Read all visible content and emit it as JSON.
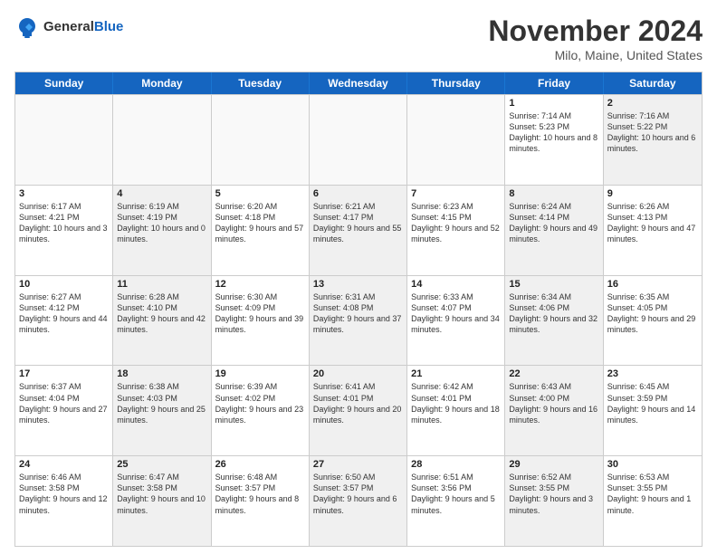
{
  "header": {
    "logo_general": "General",
    "logo_blue": "Blue",
    "title": "November 2024",
    "location": "Milo, Maine, United States"
  },
  "weekdays": [
    "Sunday",
    "Monday",
    "Tuesday",
    "Wednesday",
    "Thursday",
    "Friday",
    "Saturday"
  ],
  "rows": [
    [
      {
        "day": "",
        "text": "",
        "shaded": false,
        "empty": true
      },
      {
        "day": "",
        "text": "",
        "shaded": false,
        "empty": true
      },
      {
        "day": "",
        "text": "",
        "shaded": false,
        "empty": true
      },
      {
        "day": "",
        "text": "",
        "shaded": false,
        "empty": true
      },
      {
        "day": "",
        "text": "",
        "shaded": false,
        "empty": true
      },
      {
        "day": "1",
        "text": "Sunrise: 7:14 AM\nSunset: 5:23 PM\nDaylight: 10 hours and 8 minutes.",
        "shaded": false,
        "empty": false
      },
      {
        "day": "2",
        "text": "Sunrise: 7:16 AM\nSunset: 5:22 PM\nDaylight: 10 hours and 6 minutes.",
        "shaded": true,
        "empty": false
      }
    ],
    [
      {
        "day": "3",
        "text": "Sunrise: 6:17 AM\nSunset: 4:21 PM\nDaylight: 10 hours and 3 minutes.",
        "shaded": false,
        "empty": false
      },
      {
        "day": "4",
        "text": "Sunrise: 6:19 AM\nSunset: 4:19 PM\nDaylight: 10 hours and 0 minutes.",
        "shaded": true,
        "empty": false
      },
      {
        "day": "5",
        "text": "Sunrise: 6:20 AM\nSunset: 4:18 PM\nDaylight: 9 hours and 57 minutes.",
        "shaded": false,
        "empty": false
      },
      {
        "day": "6",
        "text": "Sunrise: 6:21 AM\nSunset: 4:17 PM\nDaylight: 9 hours and 55 minutes.",
        "shaded": true,
        "empty": false
      },
      {
        "day": "7",
        "text": "Sunrise: 6:23 AM\nSunset: 4:15 PM\nDaylight: 9 hours and 52 minutes.",
        "shaded": false,
        "empty": false
      },
      {
        "day": "8",
        "text": "Sunrise: 6:24 AM\nSunset: 4:14 PM\nDaylight: 9 hours and 49 minutes.",
        "shaded": true,
        "empty": false
      },
      {
        "day": "9",
        "text": "Sunrise: 6:26 AM\nSunset: 4:13 PM\nDaylight: 9 hours and 47 minutes.",
        "shaded": false,
        "empty": false
      }
    ],
    [
      {
        "day": "10",
        "text": "Sunrise: 6:27 AM\nSunset: 4:12 PM\nDaylight: 9 hours and 44 minutes.",
        "shaded": false,
        "empty": false
      },
      {
        "day": "11",
        "text": "Sunrise: 6:28 AM\nSunset: 4:10 PM\nDaylight: 9 hours and 42 minutes.",
        "shaded": true,
        "empty": false
      },
      {
        "day": "12",
        "text": "Sunrise: 6:30 AM\nSunset: 4:09 PM\nDaylight: 9 hours and 39 minutes.",
        "shaded": false,
        "empty": false
      },
      {
        "day": "13",
        "text": "Sunrise: 6:31 AM\nSunset: 4:08 PM\nDaylight: 9 hours and 37 minutes.",
        "shaded": true,
        "empty": false
      },
      {
        "day": "14",
        "text": "Sunrise: 6:33 AM\nSunset: 4:07 PM\nDaylight: 9 hours and 34 minutes.",
        "shaded": false,
        "empty": false
      },
      {
        "day": "15",
        "text": "Sunrise: 6:34 AM\nSunset: 4:06 PM\nDaylight: 9 hours and 32 minutes.",
        "shaded": true,
        "empty": false
      },
      {
        "day": "16",
        "text": "Sunrise: 6:35 AM\nSunset: 4:05 PM\nDaylight: 9 hours and 29 minutes.",
        "shaded": false,
        "empty": false
      }
    ],
    [
      {
        "day": "17",
        "text": "Sunrise: 6:37 AM\nSunset: 4:04 PM\nDaylight: 9 hours and 27 minutes.",
        "shaded": false,
        "empty": false
      },
      {
        "day": "18",
        "text": "Sunrise: 6:38 AM\nSunset: 4:03 PM\nDaylight: 9 hours and 25 minutes.",
        "shaded": true,
        "empty": false
      },
      {
        "day": "19",
        "text": "Sunrise: 6:39 AM\nSunset: 4:02 PM\nDaylight: 9 hours and 23 minutes.",
        "shaded": false,
        "empty": false
      },
      {
        "day": "20",
        "text": "Sunrise: 6:41 AM\nSunset: 4:01 PM\nDaylight: 9 hours and 20 minutes.",
        "shaded": true,
        "empty": false
      },
      {
        "day": "21",
        "text": "Sunrise: 6:42 AM\nSunset: 4:01 PM\nDaylight: 9 hours and 18 minutes.",
        "shaded": false,
        "empty": false
      },
      {
        "day": "22",
        "text": "Sunrise: 6:43 AM\nSunset: 4:00 PM\nDaylight: 9 hours and 16 minutes.",
        "shaded": true,
        "empty": false
      },
      {
        "day": "23",
        "text": "Sunrise: 6:45 AM\nSunset: 3:59 PM\nDaylight: 9 hours and 14 minutes.",
        "shaded": false,
        "empty": false
      }
    ],
    [
      {
        "day": "24",
        "text": "Sunrise: 6:46 AM\nSunset: 3:58 PM\nDaylight: 9 hours and 12 minutes.",
        "shaded": false,
        "empty": false
      },
      {
        "day": "25",
        "text": "Sunrise: 6:47 AM\nSunset: 3:58 PM\nDaylight: 9 hours and 10 minutes.",
        "shaded": true,
        "empty": false
      },
      {
        "day": "26",
        "text": "Sunrise: 6:48 AM\nSunset: 3:57 PM\nDaylight: 9 hours and 8 minutes.",
        "shaded": false,
        "empty": false
      },
      {
        "day": "27",
        "text": "Sunrise: 6:50 AM\nSunset: 3:57 PM\nDaylight: 9 hours and 6 minutes.",
        "shaded": true,
        "empty": false
      },
      {
        "day": "28",
        "text": "Sunrise: 6:51 AM\nSunset: 3:56 PM\nDaylight: 9 hours and 5 minutes.",
        "shaded": false,
        "empty": false
      },
      {
        "day": "29",
        "text": "Sunrise: 6:52 AM\nSunset: 3:55 PM\nDaylight: 9 hours and 3 minutes.",
        "shaded": true,
        "empty": false
      },
      {
        "day": "30",
        "text": "Sunrise: 6:53 AM\nSunset: 3:55 PM\nDaylight: 9 hours and 1 minute.",
        "shaded": false,
        "empty": false
      }
    ]
  ]
}
